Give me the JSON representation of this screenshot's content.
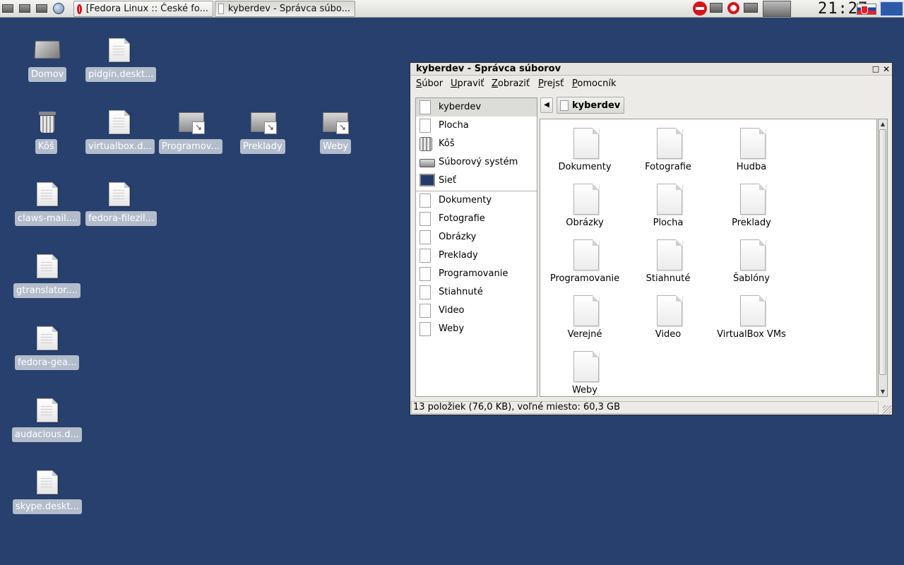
{
  "taskbar": {
    "tasks": [
      {
        "label": "[Fedora Linux :: České fo...",
        "icon": "opera-icon"
      },
      {
        "label": "kyberdev - Správca súbo...",
        "icon": "document-icon"
      }
    ],
    "clock": "21:27"
  },
  "desktop": {
    "icons": [
      {
        "label": "Domov",
        "icon": "home-folder-icon"
      },
      {
        "label": "pidgin.deskt...",
        "icon": "file-icon"
      },
      {
        "label": "Kôš",
        "icon": "trash-icon"
      },
      {
        "label": "virtualbox.d...",
        "icon": "file-icon"
      },
      {
        "label": "Programov...",
        "icon": "link-icon"
      },
      {
        "label": "Preklady",
        "icon": "link-icon"
      },
      {
        "label": "Weby",
        "icon": "link-icon"
      },
      {
        "label": "claws-mail....",
        "icon": "file-icon"
      },
      {
        "label": "fedora-filezil...",
        "icon": "file-icon"
      },
      {
        "label": "gtranslator....",
        "icon": "file-icon"
      },
      {
        "label": "fedora-gea...",
        "icon": "file-icon"
      },
      {
        "label": "audacious.d...",
        "icon": "file-icon"
      },
      {
        "label": "skype.deskt...",
        "icon": "file-icon"
      }
    ]
  },
  "window": {
    "title": "kyberdev - Správca súborov",
    "menu": [
      "Súbor",
      "Upraviť",
      "Zobraziť",
      "Prejsť",
      "Pomocník"
    ],
    "places": [
      {
        "label": "kyberdev",
        "icon": "home-icon",
        "selected": true
      },
      {
        "label": "Plocha",
        "icon": "desktop-icon"
      },
      {
        "label": "Kôš",
        "icon": "trash-icon"
      },
      {
        "label": "Súborový systém",
        "icon": "drive-icon"
      },
      {
        "label": "Sieť",
        "icon": "network-icon"
      }
    ],
    "bookmarks": [
      "Dokumenty",
      "Fotografie",
      "Obrázky",
      "Preklady",
      "Programovanie",
      "Stiahnuté",
      "Video",
      "Weby"
    ],
    "path": "kyberdev",
    "files": [
      "Dokumenty",
      "Fotografie",
      "Hudba",
      "Obrázky",
      "Plocha",
      "Preklady",
      "Programovanie",
      "Stiahnuté",
      "Šablóny",
      "Verejné",
      "Video",
      "VirtualBox VMs",
      "Weby"
    ],
    "status": "13 položiek (76,0 KB), voľné miesto: 60,3 GB"
  },
  "colors": {
    "desktop": "#27406e",
    "label_bg": "#b3bccb",
    "selection": "#dcdcd8"
  }
}
